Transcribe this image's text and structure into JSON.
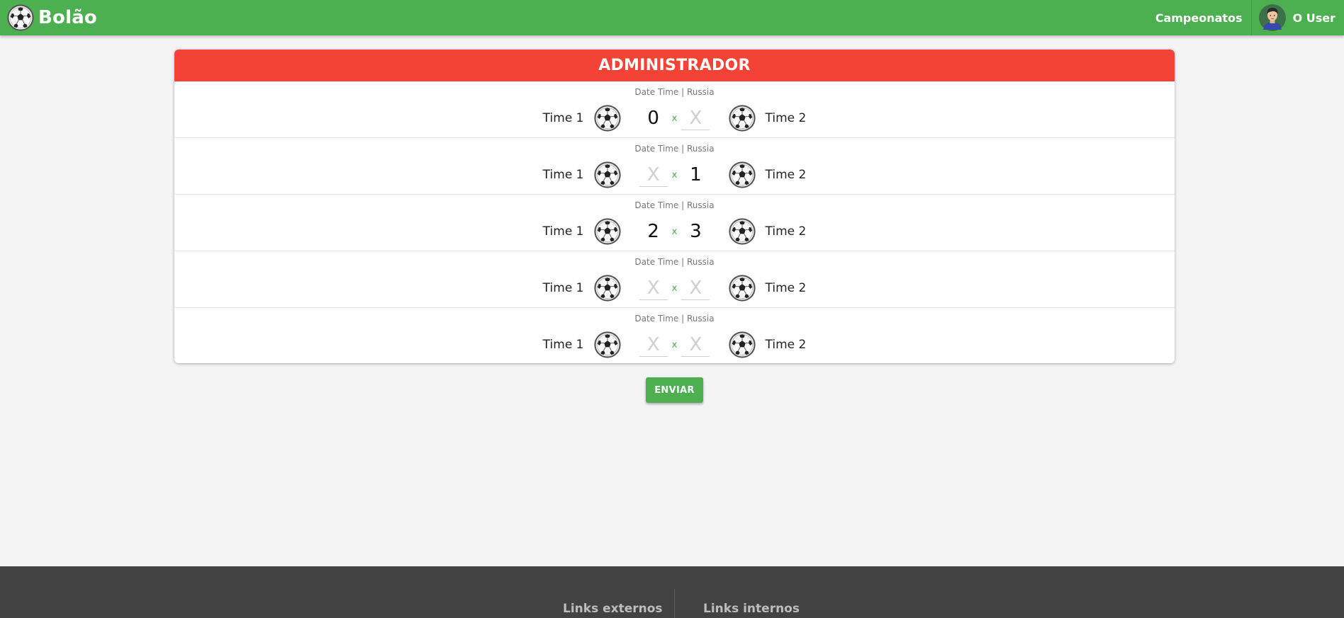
{
  "navbar": {
    "brand": "Bolão",
    "brand_icon": "soccer-ball-icon",
    "links": [
      {
        "label": "Campeonatos"
      }
    ],
    "user": {
      "name": "O User",
      "avatar_icon": "user-avatar-icon"
    }
  },
  "panel": {
    "title": "ADMINISTRADOR",
    "matches": [
      {
        "meta": "Date Time | Russia",
        "team1": "Time 1",
        "team2": "Time 2",
        "score1": "0",
        "score2": "",
        "placeholder": "X",
        "separator": "x"
      },
      {
        "meta": "Date Time | Russia",
        "team1": "Time 1",
        "team2": "Time 2",
        "score1": "",
        "score2": "1",
        "placeholder": "X",
        "separator": "x"
      },
      {
        "meta": "Date Time | Russia",
        "team1": "Time 1",
        "team2": "Time 2",
        "score1": "2",
        "score2": "3",
        "placeholder": "X",
        "separator": "x"
      },
      {
        "meta": "Date Time | Russia",
        "team1": "Time 1",
        "team2": "Time 2",
        "score1": "",
        "score2": "",
        "placeholder": "X",
        "separator": "x"
      },
      {
        "meta": "Date Time | Russia",
        "team1": "Time 1",
        "team2": "Time 2",
        "score1": "",
        "score2": "",
        "placeholder": "X",
        "separator": "x"
      }
    ]
  },
  "actions": {
    "submit_label": "ENVIAR"
  },
  "footer": {
    "columns": [
      {
        "title": "Links externos"
      },
      {
        "title": "Links internos"
      }
    ]
  },
  "colors": {
    "navbar": "#4caf50",
    "panel_header": "#f44336",
    "button": "#4caf50",
    "footer": "#424242",
    "background": "#f4f4f4"
  }
}
